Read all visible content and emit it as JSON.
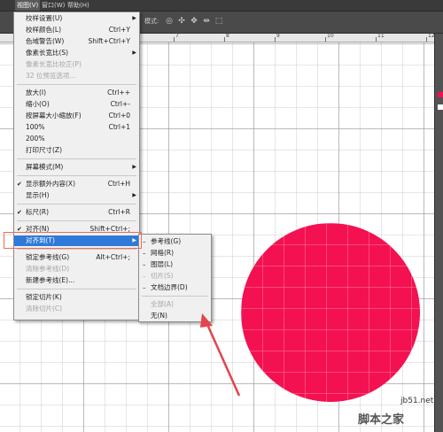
{
  "menubar": {
    "items": [
      {
        "label": "视图(V)"
      },
      {
        "label": "窗口(W)"
      },
      {
        "label": "帮助(H)"
      }
    ]
  },
  "optionsbar": {
    "mode_label": "模式:"
  },
  "ruler": {
    "labels": [
      "7",
      "8",
      "9",
      "10",
      "11",
      "12"
    ]
  },
  "colors": {
    "circle": "#f41151",
    "menu_highlight": "#2f7ad8",
    "callout": "#e2454a"
  },
  "view_menu": {
    "items": [
      {
        "label": "校样设置(U)",
        "shortcut": "",
        "submenu": true
      },
      {
        "label": "校样颜色(L)",
        "shortcut": "Ctrl+Y"
      },
      {
        "label": "色域警告(W)",
        "shortcut": "Shift+Ctrl+Y"
      },
      {
        "label": "像素长宽比(S)",
        "shortcut": "",
        "submenu": true
      },
      {
        "label": "像素长宽比校正(P)",
        "shortcut": "",
        "disabled": true
      },
      {
        "label": "32 位预览选项...",
        "shortcut": "",
        "disabled": true
      },
      {
        "label": "放大(I)",
        "shortcut": "Ctrl++"
      },
      {
        "label": "缩小(O)",
        "shortcut": "Ctrl+-"
      },
      {
        "label": "按屏幕大小缩放(F)",
        "shortcut": "Ctrl+0"
      },
      {
        "label": "100%",
        "shortcut": "Ctrl+1"
      },
      {
        "label": "200%",
        "shortcut": ""
      },
      {
        "label": "打印尺寸(Z)",
        "shortcut": ""
      },
      {
        "label": "屏幕模式(M)",
        "shortcut": "",
        "submenu": true
      },
      {
        "label": "显示额外内容(X)",
        "shortcut": "Ctrl+H",
        "checked": true
      },
      {
        "label": "显示(H)",
        "shortcut": "",
        "submenu": true
      },
      {
        "label": "标尺(R)",
        "shortcut": "Ctrl+R",
        "checked": true
      },
      {
        "label": "对齐(N)",
        "shortcut": "Shift+Ctrl+;",
        "checked": true
      },
      {
        "label": "对齐到(T)",
        "shortcut": "",
        "submenu": true,
        "highlight": true
      },
      {
        "label": "锁定参考线(G)",
        "shortcut": "Alt+Ctrl+;"
      },
      {
        "label": "清除参考线(D)",
        "shortcut": "",
        "disabled": true
      },
      {
        "label": "新建参考线(E)...",
        "shortcut": ""
      },
      {
        "label": "锁定切片(K)",
        "shortcut": ""
      },
      {
        "label": "清除切片(C)",
        "shortcut": "",
        "disabled": true
      }
    ]
  },
  "snap_submenu": {
    "items": [
      {
        "label": "参考线(G)",
        "checked": true
      },
      {
        "label": "网格(R)",
        "checked": true
      },
      {
        "label": "图层(L)",
        "checked": true
      },
      {
        "label": "切片(S)",
        "checked": true,
        "disabled": true
      },
      {
        "label": "文档边界(D)",
        "checked": true
      },
      {
        "label": "全部(A)",
        "disabled": true
      },
      {
        "label": "无(N)"
      }
    ]
  },
  "watermark": {
    "url": "jb51.net",
    "logo": "脚本之家"
  }
}
